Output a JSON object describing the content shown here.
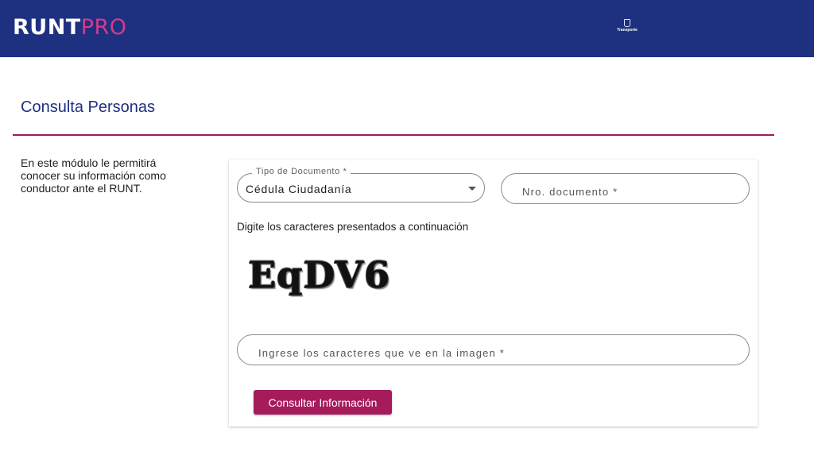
{
  "header": {
    "logo_part1": "RUNT",
    "logo_part2": "PRO",
    "mini_label": "Transporte",
    "background_color": "#1e3080",
    "accent_color": "#d43b8b"
  },
  "main": {
    "title": "Consulta Personas",
    "description": "En este módulo le permitirá conocer su información como conductor ante el RUNT."
  },
  "form": {
    "tipo_documento": {
      "label": "Tipo de Documento  *",
      "value": "Cédula Ciudadanía",
      "icon": "caret-down-icon"
    },
    "nro_documento": {
      "placeholder": "Nro. documento   *"
    },
    "captcha_hint": "Digite los caracteres presentados a continuación",
    "captcha_text": "EqDV6",
    "captcha_input": {
      "placeholder": "Ingrese los caracteres que ve en la imagen *"
    },
    "submit_label": "Consultar Información",
    "button_color": "#a51b5c"
  }
}
